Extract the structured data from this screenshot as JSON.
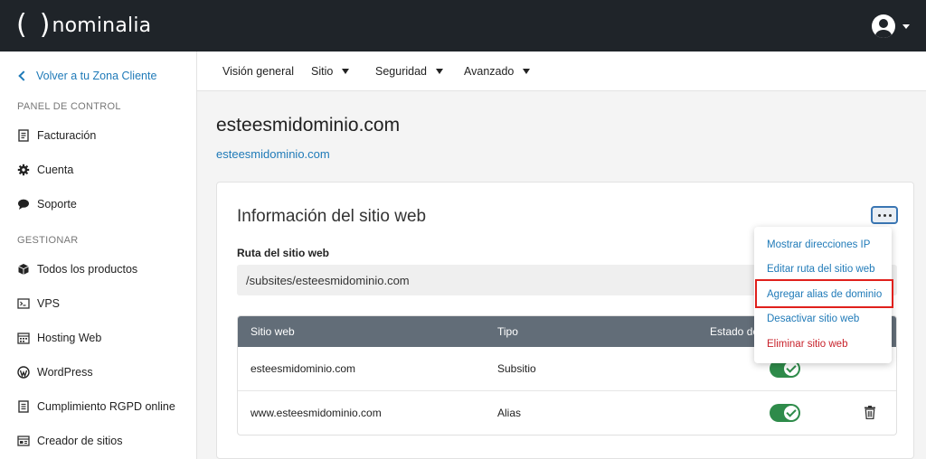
{
  "header": {
    "logo_parens_left": "(",
    "logo_parens_right": ")",
    "brand": "nominalia"
  },
  "sidebar": {
    "back_label": "Volver a tu Zona Cliente",
    "sections": [
      {
        "label": "PANEL DE CONTROL",
        "items": [
          {
            "label": "Facturación",
            "icon": "invoice-icon"
          },
          {
            "label": "Cuenta",
            "icon": "gear-icon"
          },
          {
            "label": "Soporte",
            "icon": "chat-bubble-icon"
          }
        ]
      },
      {
        "label": "GESTIONAR",
        "items": [
          {
            "label": "Todos los productos",
            "icon": "boxes-icon"
          },
          {
            "label": "VPS",
            "icon": "terminal-icon"
          },
          {
            "label": "Hosting Web",
            "icon": "calendar-grid-icon"
          },
          {
            "label": "WordPress",
            "icon": "wordpress-icon"
          },
          {
            "label": "Cumplimiento RGPD online",
            "icon": "document-icon"
          },
          {
            "label": "Creador de sitios",
            "icon": "site-builder-icon"
          }
        ]
      }
    ]
  },
  "tabs": [
    {
      "label": "Visión general"
    },
    {
      "label": "Sitio"
    },
    {
      "label": "Seguridad"
    },
    {
      "label": "Avanzado"
    }
  ],
  "page": {
    "title": "esteesmidominio.com",
    "link": "esteesmidominio.com"
  },
  "card": {
    "title": "Información del sitio web",
    "path_label": "Ruta del sitio web",
    "path_value": "/subsites/esteesmidominio.com",
    "table": {
      "headers": [
        "Sitio web",
        "Tipo",
        "Estado de"
      ],
      "rows": [
        {
          "site": "esteesmidominio.com",
          "type": "Subsitio",
          "enabled": true
        },
        {
          "site": "www.esteesmidominio.com",
          "type": "Alias",
          "enabled": true
        }
      ]
    }
  },
  "dropdown": {
    "items": [
      {
        "label": "Mostrar direcciones IP"
      },
      {
        "label": "Editar ruta del sitio web"
      },
      {
        "label": "Agregar alias de dominio"
      },
      {
        "label": "Desactivar sitio web"
      },
      {
        "label": "Eliminar sitio web"
      }
    ],
    "highlighted_index": 2
  },
  "colors": {
    "topbar": "#1f2429",
    "link": "#1f7ab8",
    "toggle_on": "#2e8b4a",
    "danger": "#c8232c",
    "highlight": "#e0201c"
  }
}
